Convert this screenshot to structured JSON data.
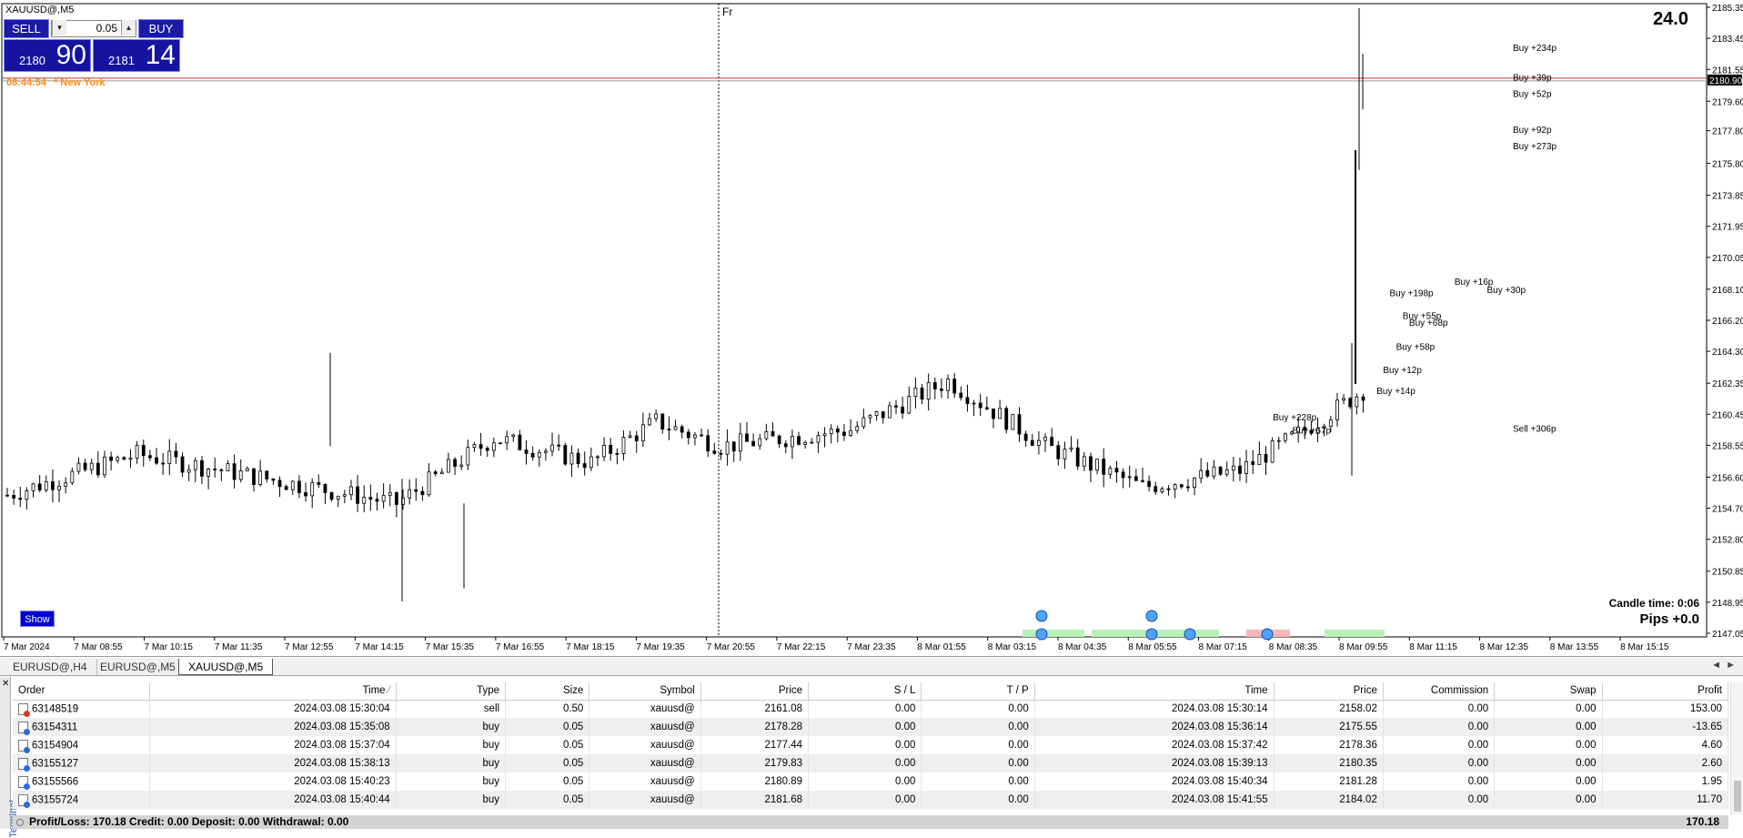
{
  "chart": {
    "symbol_title": "XAUUSD@,M5",
    "spread": "24.0",
    "candle_time": "Candle time:  0:06",
    "pips": "Pips +0.0",
    "show_button": "Show",
    "session_marker": "Fr",
    "current_price": "2180.90",
    "current_price_value": 2180.9,
    "ny_time": "08:44:54",
    "ny_label": "* New York",
    "colors": {
      "current_price_line": "#c0392b",
      "panel_blue": "#1414a0",
      "ny_orange": "#ff8c1a",
      "buy_zone": "#b8f0b8",
      "sell_zone": "#f5b7b7"
    },
    "price_axis": [
      "2185.35",
      "2183.45",
      "2181.55",
      "2179.60",
      "2177.80",
      "2175.80",
      "2173.85",
      "2171.95",
      "2170.05",
      "2168.10",
      "2166.20",
      "2164.30",
      "2162.35",
      "2160.45",
      "2158.55",
      "2156.60",
      "2154.70",
      "2152.80",
      "2150.85",
      "2148.95",
      "2147.05"
    ],
    "price_range": [
      2147.05,
      2185.35
    ],
    "time_axis": [
      "7 Mar 2024",
      "7 Mar 08:55",
      "7 Mar 10:15",
      "7 Mar 11:35",
      "7 Mar 12:55",
      "7 Mar 14:15",
      "7 Mar 15:35",
      "7 Mar 16:55",
      "7 Mar 18:15",
      "7 Mar 19:35",
      "7 Mar 20:55",
      "7 Mar 22:15",
      "7 Mar 23:35",
      "8 Mar 01:55",
      "8 Mar 03:15",
      "8 Mar 04:35",
      "8 Mar 05:55",
      "8 Mar 07:15",
      "8 Mar 08:35",
      "8 Mar 09:55",
      "8 Mar 11:15",
      "8 Mar 12:35",
      "8 Mar 13:55",
      "8 Mar 15:15"
    ],
    "trade_labels": [
      {
        "text": "Buy +234p",
        "price": 2182.9,
        "bar": 236
      },
      {
        "text": "Buy +39p",
        "price": 2181.1,
        "bar": 236
      },
      {
        "text": "Buy +52p",
        "price": 2180.1,
        "bar": 236
      },
      {
        "text": "Buy +92p",
        "price": 2177.9,
        "bar": 236
      },
      {
        "text": "Buy +273p",
        "price": 2176.9,
        "bar": 236
      },
      {
        "text": "Sell +306p",
        "price": 2159.6,
        "bar": 236
      },
      {
        "text": "Buy +198p",
        "price": 2167.9,
        "bar": 217
      },
      {
        "text": "Buy +16p",
        "price": 2168.6,
        "bar": 227
      },
      {
        "text": "Buy +30p",
        "price": 2168.1,
        "bar": 232
      },
      {
        "text": "Buy +55p",
        "price": 2166.5,
        "bar": 219
      },
      {
        "text": "Buy +68p",
        "price": 2166.1,
        "bar": 220
      },
      {
        "text": "Buy +58p",
        "price": 2164.6,
        "bar": 218
      },
      {
        "text": "Buy +12p",
        "price": 2163.2,
        "bar": 216
      },
      {
        "text": "Buy +14p",
        "price": 2161.9,
        "bar": 215
      },
      {
        "text": "Buy +228p",
        "price": 2160.3,
        "bar": 199
      },
      {
        "text": "Buy +67p",
        "price": 2159.5,
        "bar": 202
      }
    ],
    "trade_panel": {
      "sell_label": "SELL",
      "buy_label": "BUY",
      "lot": "0.05",
      "sell_small": "2180",
      "sell_big": "90",
      "buy_small": "2181",
      "buy_big": "14"
    }
  },
  "chart_tabs": [
    {
      "label": "EURUSD@,H4",
      "active": false
    },
    {
      "label": "EURUSD@,M5",
      "active": false
    },
    {
      "label": "XAUUSD@,M5",
      "active": true
    }
  ],
  "terminal": {
    "side_label": "Terminal",
    "columns": [
      "Order",
      "Time",
      "Type",
      "Size",
      "Symbol",
      "Price",
      "S / L",
      "T / P",
      "Time",
      "Price",
      "Commission",
      "Swap",
      "Profit"
    ],
    "rows": [
      {
        "order": "63148519",
        "open_time": "2024.03.08 15:30:04",
        "type": "sell",
        "size": "0.50",
        "symbol": "xauusd@",
        "price": "2161.08",
        "sl": "0.00",
        "tp": "0.00",
        "close_time": "2024.03.08 15:30:14",
        "close_price": "2158.02",
        "commission": "0.00",
        "swap": "0.00",
        "profit": "153.00"
      },
      {
        "order": "63154311",
        "open_time": "2024.03.08 15:35:08",
        "type": "buy",
        "size": "0.05",
        "symbol": "xauusd@",
        "price": "2178.28",
        "sl": "0.00",
        "tp": "0.00",
        "close_time": "2024.03.08 15:36:14",
        "close_price": "2175.55",
        "commission": "0.00",
        "swap": "0.00",
        "profit": "-13.65"
      },
      {
        "order": "63154904",
        "open_time": "2024.03.08 15:37:04",
        "type": "buy",
        "size": "0.05",
        "symbol": "xauusd@",
        "price": "2177.44",
        "sl": "0.00",
        "tp": "0.00",
        "close_time": "2024.03.08 15:37:42",
        "close_price": "2178.36",
        "commission": "0.00",
        "swap": "0.00",
        "profit": "4.60"
      },
      {
        "order": "63155127",
        "open_time": "2024.03.08 15:38:13",
        "type": "buy",
        "size": "0.05",
        "symbol": "xauusd@",
        "price": "2179.83",
        "sl": "0.00",
        "tp": "0.00",
        "close_time": "2024.03.08 15:39:13",
        "close_price": "2180.35",
        "commission": "0.00",
        "swap": "0.00",
        "profit": "2.60"
      },
      {
        "order": "63155566",
        "open_time": "2024.03.08 15:40:23",
        "type": "buy",
        "size": "0.05",
        "symbol": "xauusd@",
        "price": "2180.89",
        "sl": "0.00",
        "tp": "0.00",
        "close_time": "2024.03.08 15:40:34",
        "close_price": "2181.28",
        "commission": "0.00",
        "swap": "0.00",
        "profit": "1.95"
      },
      {
        "order": "63155724",
        "open_time": "2024.03.08 15:40:44",
        "type": "buy",
        "size": "0.05",
        "symbol": "xauusd@",
        "price": "2181.68",
        "sl": "0.00",
        "tp": "0.00",
        "close_time": "2024.03.08 15:41:55",
        "close_price": "2184.02",
        "commission": "0.00",
        "swap": "0.00",
        "profit": "11.70"
      }
    ],
    "summary": "Profit/Loss: 170.18  Credit: 0.00  Deposit: 0.00  Withdrawal: 0.00",
    "summary_total": "170.18"
  }
}
